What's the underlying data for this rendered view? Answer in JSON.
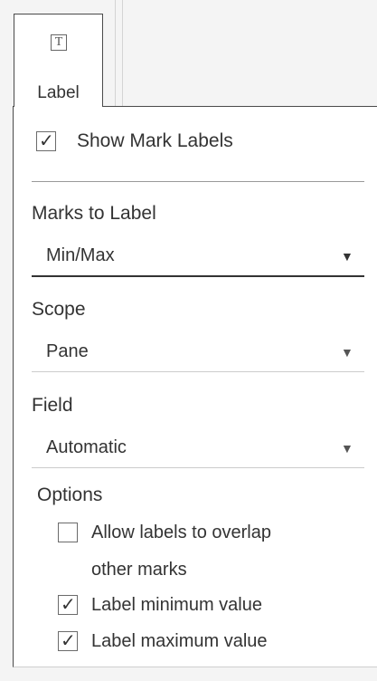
{
  "toolbar": {
    "label_card": {
      "label": "Label",
      "icon": "text-t-icon",
      "selected": true
    }
  },
  "panel": {
    "show_mark_labels": {
      "label": "Show Mark Labels",
      "checked": true
    },
    "marks_to_label": {
      "title": "Marks to Label",
      "value": "Min/Max"
    },
    "scope": {
      "title": "Scope",
      "value": "Pane"
    },
    "field": {
      "title": "Field",
      "value": "Automatic"
    },
    "options": {
      "title": "Options",
      "allow_overlap": {
        "line1": "Allow labels to overlap",
        "line2": "other marks",
        "checked": false
      },
      "label_min": {
        "label": "Label minimum value",
        "checked": true
      },
      "label_max": {
        "label": "Label maximum value",
        "checked": true
      }
    }
  },
  "icons": {
    "check": "✓",
    "caret": "▼"
  }
}
